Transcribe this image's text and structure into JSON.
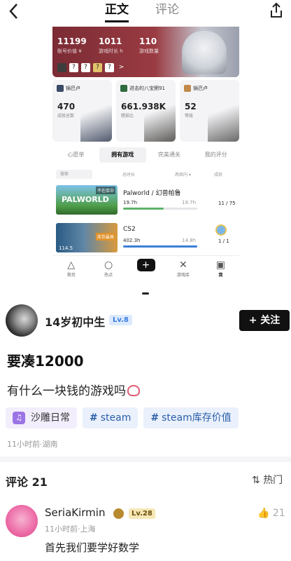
{
  "header": {
    "back_icon": "chevron-left-icon",
    "tabs": [
      {
        "label": "正文",
        "active": true
      },
      {
        "label": "评论",
        "active": false
      }
    ],
    "share_icon": "share-icon"
  },
  "embedded": {
    "banner": {
      "stats": [
        {
          "value": "11199",
          "label": "账号价值 ¥"
        },
        {
          "value": "1011",
          "label": "游戏时长 h"
        },
        {
          "value": "110",
          "label": "游戏数量"
        }
      ],
      "badges": [
        "?",
        "?",
        "?",
        "?",
        ">"
      ]
    },
    "cards": [
      {
        "source": "锅巴卢",
        "value": "470",
        "label": "成就总数"
      },
      {
        "source": "进击的八宝粥91",
        "value": "661.938K",
        "label": "精损比"
      },
      {
        "source": "锅巴卢",
        "value": "52",
        "label": "等级"
      }
    ],
    "subtabs": [
      "心愿单",
      "拥有游戏",
      "完美通关",
      "我的评分"
    ],
    "active_subtab": "拥有游戏",
    "filters": {
      "search_placeholder": "搜索",
      "sort1": "总时长",
      "sort2": "两周内 ▾",
      "sort3": "成就"
    },
    "games": [
      {
        "name": "Palworld / 幻兽帕鲁",
        "hours": "19.7h",
        "total": "19.7h",
        "achievements": "11 / 75",
        "progress": 0.55,
        "bar_color": "#5fb36a",
        "cover_tag": "不在库中",
        "cover_title": "PALWORLD"
      },
      {
        "name": "CS2",
        "hours": "402.3h",
        "total": "14.8h",
        "achievements": "1 / 1",
        "progress": 1.0,
        "bar_color": "#3c7fd6",
        "cover_tag": "库存最高",
        "cover_title": "114.5"
      }
    ],
    "appnav": [
      {
        "label": "首页",
        "icon": "triangle-icon"
      },
      {
        "label": "热点",
        "icon": "circle-icon"
      },
      {
        "label": "",
        "icon": "plus-icon"
      },
      {
        "label": "游戏库",
        "icon": "cross-icon"
      },
      {
        "label": "我",
        "icon": "square-icon"
      }
    ]
  },
  "author": {
    "name": "14岁初中生",
    "level": "Lv.8",
    "follow_label": "+ 关注"
  },
  "post": {
    "title": "要凑12000",
    "body": "有什么一块钱的游戏吗",
    "tags": [
      {
        "type": "topic",
        "label": "沙雕日常"
      },
      {
        "type": "hash",
        "label": "steam"
      },
      {
        "type": "hash",
        "label": "steam库存价值"
      }
    ],
    "meta": "11小时前·湖南"
  },
  "comments_header": {
    "title": "评论 21",
    "sort_label": "热门"
  },
  "comments": [
    {
      "name": "SeriaKirmin",
      "level": "Lv.28",
      "time": "11小时前·上海",
      "text": "首先我们要学好数学",
      "likes": "21"
    }
  ],
  "colors": {
    "accent": "#111111",
    "tag_blue": "#2a5ea8",
    "level_blue": "#3b7de0"
  }
}
